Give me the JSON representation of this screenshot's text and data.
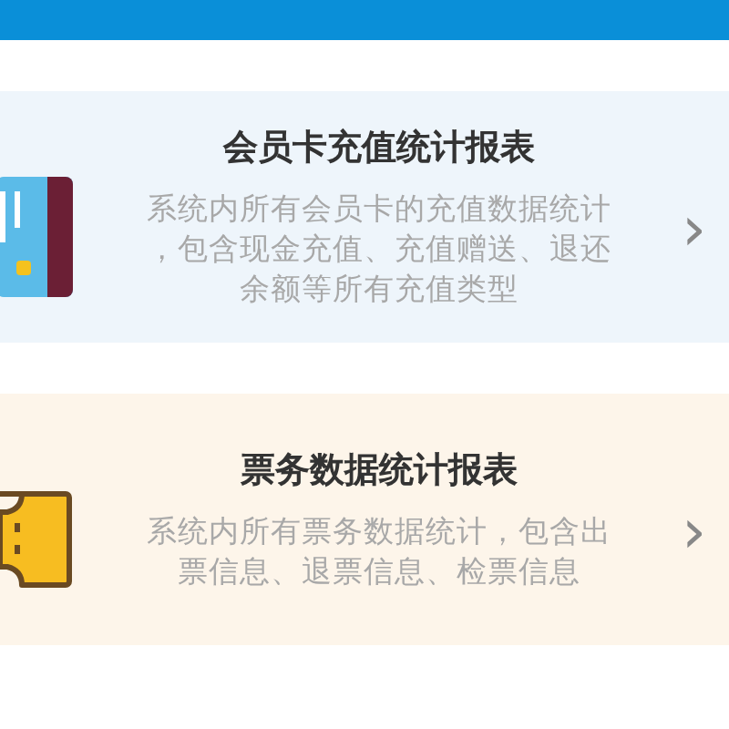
{
  "reports": [
    {
      "kind": "card",
      "title": "会员卡充值统计报表",
      "description_lines": [
        "系统内所有会员卡的充值数据统计",
        "，包含现金充值、充值赠送、退还",
        "余额等所有充值类型"
      ],
      "chevron": "›"
    },
    {
      "kind": "ticket",
      "title": "票务数据统计报表",
      "description_lines": [
        "系统内所有票务数据统计，包含出",
        "票信息、退票信息、检票信息"
      ],
      "chevron": "›"
    }
  ]
}
